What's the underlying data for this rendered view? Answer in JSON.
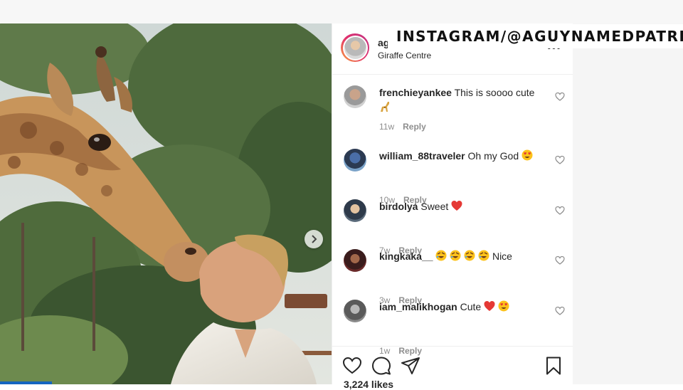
{
  "watermark": {
    "text": "INSTAGRAM/@AGUYNAMEDPATRICK"
  },
  "post": {
    "username_partial": "ag",
    "location": "Giraffe Centre",
    "more_label": "•••",
    "likes_text": "3,224 likes"
  },
  "comments": [
    {
      "user": "frenchieyankee",
      "text": "This is soooo cute",
      "emoji": [
        "giraffe"
      ],
      "age": "11w",
      "reply": "Reply"
    },
    {
      "user": "william_88traveler",
      "text": "Oh my God",
      "emoji": [
        "heart-eyes"
      ],
      "age": "10w",
      "reply": "Reply"
    },
    {
      "user": "birdolya",
      "text": "Sweet",
      "emoji": [
        "red-heart"
      ],
      "age": "7w",
      "reply": "Reply"
    },
    {
      "user": "kingkaka__",
      "text": "Nice",
      "emoji": [
        "rolling-laughing",
        "rolling-laughing",
        "rolling-laughing",
        "rolling-laughing"
      ],
      "age": "3w",
      "reply": "Reply"
    },
    {
      "user": "iam_malikhogan",
      "text": "Cute",
      "emoji": [
        "red-heart",
        "heart-eyes"
      ],
      "age": "1w",
      "reply": "Reply"
    }
  ],
  "icons": {
    "like": "heart-icon",
    "comment": "comment-icon",
    "share": "paper-plane-icon",
    "save": "bookmark-icon",
    "carousel_next": "chevron-right-icon"
  },
  "colors": {
    "accent_heart": "#ed4956",
    "meta_gray": "#8e8e8e",
    "story_ring": "#e1306c"
  }
}
